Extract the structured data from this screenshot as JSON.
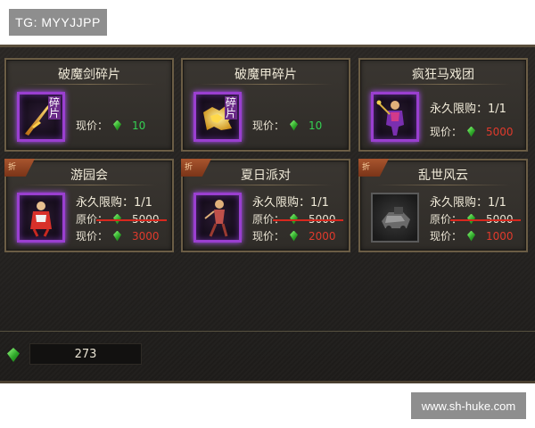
{
  "watermark_top": "TG: MYYJJPP",
  "watermark_bottom": "www.sh-huke.com",
  "labels": {
    "price_now": "现价：",
    "price_orig": "原价：",
    "limit": "永久限购：1/1",
    "shard_tag": "碎片",
    "sale_ribbon": "折"
  },
  "cards": [
    {
      "title": "破魔剑碎片",
      "icon": "sword-shard-icon",
      "price_now": "10",
      "price_now_color": "#34d152"
    },
    {
      "title": "破魔甲碎片",
      "icon": "armor-shard-icon",
      "price_now": "10",
      "price_now_color": "#34d152"
    },
    {
      "title": "疯狂马戏团",
      "icon": "circus-costume-icon",
      "price_now": "5000",
      "price_now_color": "#e03a2c"
    },
    {
      "title": "游园会",
      "icon": "fair-costume-icon",
      "price_orig": "5000",
      "price_now": "3000",
      "price_now_color": "#e03a2c"
    },
    {
      "title": "夏日派对",
      "icon": "summer-party-costume-icon",
      "price_orig": "5000",
      "price_now": "2000",
      "price_now_color": "#e03a2c"
    },
    {
      "title": "乱世风云",
      "icon": "mech-mount-icon",
      "price_orig": "5000",
      "price_now": "1000",
      "price_now_color": "#e03a2c"
    }
  ],
  "balance": "273",
  "colors": {
    "accent_purple": "#9a3fd0",
    "card_border": "#6b5d45",
    "currency_green": "#34d152",
    "price_red": "#e03a2c"
  }
}
